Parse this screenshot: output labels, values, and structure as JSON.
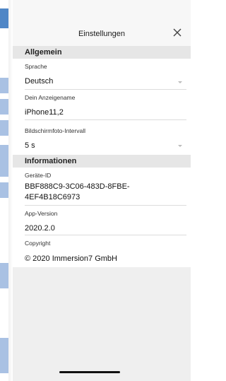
{
  "dialog": {
    "title": "Einstellungen",
    "close_icon": "close-icon"
  },
  "sections": {
    "general": "Allgemein",
    "info": "Informationen"
  },
  "fields": {
    "language": {
      "label": "Sprache",
      "value": "Deutsch"
    },
    "display_name": {
      "label": "Dein Anzeigename",
      "value": "iPhone11,2"
    },
    "screenshot_interval": {
      "label": "Bildschirmfoto-Intervall",
      "value": "5 s"
    },
    "device_id": {
      "label": "Geräte-ID",
      "value_line1": "BBF888C9-3C06-483D-8FBE-",
      "value_line2": "4EF4B18C6973"
    },
    "app_version": {
      "label": "App-Version",
      "value": "2020.2.0"
    },
    "copyright": {
      "label": "Copyright",
      "value": "© 2020 Immersion7 GmbH"
    }
  },
  "colors": {
    "sheet_bg": "#efefef",
    "section_bg": "#e6e6e6",
    "accent_strip": "#4f86c6"
  }
}
